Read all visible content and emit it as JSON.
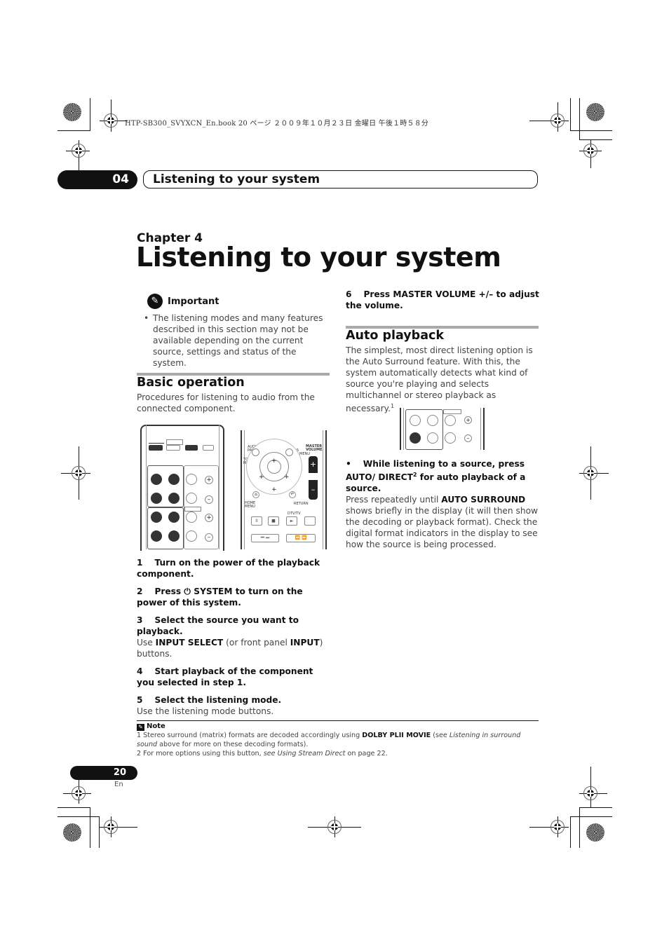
{
  "print_header": "HTP-SB300_SVYXCN_En.book  20 ページ  ２００９年１０月２３日  金曜日  午後１時５８分",
  "tab": {
    "number": "04",
    "title": "Listening to your system"
  },
  "chapter": {
    "label": "Chapter 4",
    "title": "Listening to your system"
  },
  "important": {
    "heading": "Important",
    "bullet": "The listening modes and many features described in this section may not be available depending on the current source, settings and status of the system."
  },
  "basic_operation": {
    "title": "Basic operation",
    "intro": "Procedures for listening to audio from the connected component.",
    "remote_labels": {
      "audio_parameter": "AUDIO PARAMETER",
      "tools": "TOOLS",
      "top_menu": "TOP MENU",
      "menu": "MENU",
      "master_volume": "MASTER VOLUME",
      "home_menu": "HOME MENU",
      "return": "RETURN",
      "dtv_tv": "DTV/TV"
    },
    "steps": [
      {
        "num": "1",
        "title": "Turn on the power of the playback component."
      },
      {
        "num": "2",
        "title": "Press ⏻ SYSTEM to turn on the power of this system."
      },
      {
        "num": "3",
        "title": "Select the source you want to playback.",
        "body_pre": "Use ",
        "b1": "INPUT SELECT",
        "body_mid": " (or front panel ",
        "b2": "INPUT",
        "body_post": ") buttons."
      },
      {
        "num": "4",
        "title": "Start playback of the component you selected in step 1."
      },
      {
        "num": "5",
        "title": "Select the listening mode.",
        "body": "Use the listening mode buttons."
      },
      {
        "num": "6",
        "title": "Press MASTER VOLUME +/– to adjust the volume."
      }
    ]
  },
  "auto_playback": {
    "title": "Auto playback",
    "intro": "The simplest, most direct listening option is the Auto Surround feature. With this, the system automatically detects what kind of source you're playing and selects multichannel or stereo playback as necessary.",
    "intro_sup": "1",
    "bullet_title_a": "While listening to a source, press AUTO/ DIRECT",
    "bullet_sup": "2",
    "bullet_title_b": " for auto playback of a source.",
    "body_pre": "Press repeatedly until ",
    "body_bold": "AUTO SURROUND",
    "body_post": " shows briefly in the display (it will then show the decoding or playback format). Check the digital format indicators in the display to see how the source is being processed."
  },
  "note": {
    "heading": "Note",
    "n1_pre": "1 Stereo surround (matrix) formats are decoded accordingly using ",
    "n1_bold": "DOLBY PLII MOVIE",
    "n1_mid": " (see ",
    "n1_ital": "Listening in surround sound",
    "n1_post": " above for more on these decoding formats).",
    "n2_pre": "2 For more options using this button, ",
    "n2_ital": "see Using Stream Direct",
    "n2_post": " on page 22."
  },
  "footer": {
    "page": "20",
    "lang": "En"
  }
}
